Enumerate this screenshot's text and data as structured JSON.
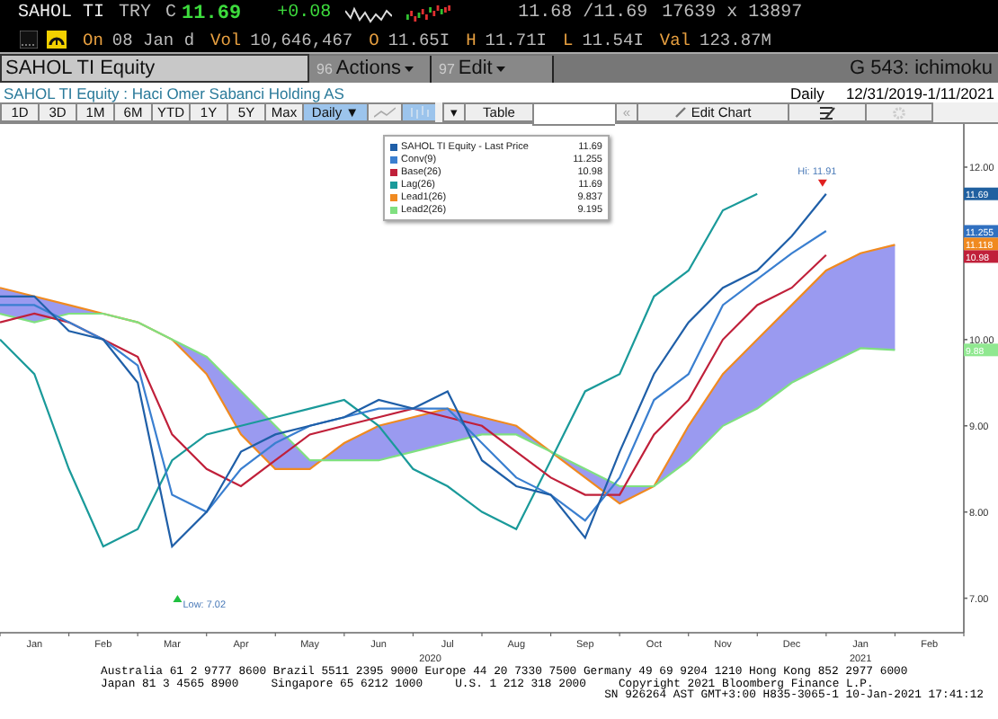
{
  "quote": {
    "ticker": "SAHOL TI",
    "currency": "TRY",
    "price_flag": "C",
    "last": "11.69",
    "change": "+0.08",
    "bid_ask": "11.68 /11.69",
    "size": "17639 x 13897"
  },
  "stats": [
    {
      "label": "On",
      "value": "08 Jan d"
    },
    {
      "label": "Vol",
      "value": "10,646,467"
    },
    {
      "label": "O",
      "value": "11.65I"
    },
    {
      "label": "H",
      "value": "11.71I"
    },
    {
      "label": "L",
      "value": "11.54I"
    },
    {
      "label": "Val",
      "value": "123.87M"
    }
  ],
  "command_bar": {
    "security": "SAHOL TI Equity",
    "menus": [
      {
        "number": "96",
        "label": "Actions"
      },
      {
        "number": "97",
        "label": "Edit"
      }
    ],
    "function": "G 543: ichimoku"
  },
  "chart_header": {
    "title": "SAHOL TI Equity : Haci Omer Sabanci Holding AS",
    "periodicity": "Daily",
    "range": "12/31/2019-1/11/2021"
  },
  "toolbar": {
    "ranges": [
      {
        "label": "1D",
        "selected": false
      },
      {
        "label": "3D",
        "selected": false
      },
      {
        "label": "1M",
        "selected": false
      },
      {
        "label": "6M",
        "selected": false
      },
      {
        "label": "YTD",
        "selected": false
      },
      {
        "label": "1Y",
        "selected": false
      },
      {
        "label": "5Y",
        "selected": false
      },
      {
        "label": "Max",
        "selected": false
      }
    ],
    "interval": "Daily ▼",
    "dropdown": "▾",
    "table": "Table",
    "back": "«",
    "edit": "Edit Chart"
  },
  "legend_values": [
    "11.69",
    "11.255",
    "10.98",
    "11.69",
    "9.837",
    "9.195"
  ],
  "value_tags": [
    {
      "value": "11.69",
      "color": "#2060a0"
    },
    {
      "value": "11.255",
      "color": "#3070c0"
    },
    {
      "value": "11.118",
      "color": "#f08a20"
    },
    {
      "value": "10.98",
      "color": "#c0203a"
    },
    {
      "value": "9.88",
      "color": "#90e890"
    }
  ],
  "x_axis_years": [
    {
      "label": "2020"
    },
    {
      "label": "2021"
    }
  ],
  "chart_data": {
    "type": "line",
    "categories": [
      null,
      "Jan",
      null,
      "Feb",
      null,
      "Mar",
      null,
      "Apr",
      null,
      "May",
      null,
      "Jun",
      null,
      "Jul",
      null,
      "Aug",
      null,
      "Sep",
      null,
      "Oct",
      null,
      "Nov",
      null,
      "Dec",
      null,
      "Jan",
      null,
      "Feb"
    ],
    "ylim": [
      6.6,
      12.5
    ],
    "yticks": [
      {
        "value": 7,
        "label": "7.00"
      },
      {
        "value": 8,
        "label": "8.00"
      },
      {
        "value": 9,
        "label": "9.00"
      },
      {
        "value": 10,
        "label": "10.00"
      },
      {
        "value": 12,
        "label": "12.00"
      }
    ],
    "series": [
      {
        "name": "SAHOL TI Equity - Last Price",
        "color": "#1f5fa8",
        "values": [
          10.5,
          10.5,
          10.1,
          10.0,
          9.5,
          7.6,
          8.0,
          8.7,
          8.9,
          9.0,
          9.1,
          9.3,
          9.2,
          9.4,
          8.6,
          8.3,
          8.2,
          7.7,
          8.7,
          9.6,
          10.2,
          10.6,
          10.8,
          11.2,
          11.69,
          null,
          null,
          null
        ]
      },
      {
        "name": "Conv(9)",
        "color": "#3a7fd0",
        "values": [
          10.4,
          10.4,
          10.2,
          10.0,
          9.7,
          8.2,
          8.0,
          8.5,
          8.8,
          9.0,
          9.1,
          9.2,
          9.2,
          9.2,
          8.8,
          8.4,
          8.2,
          7.9,
          8.4,
          9.3,
          9.6,
          10.4,
          10.7,
          11.0,
          11.26,
          null,
          null,
          null
        ]
      },
      {
        "name": "Base(26)",
        "color": "#c0203a",
        "values": [
          10.2,
          10.3,
          10.2,
          10.0,
          9.8,
          8.9,
          8.5,
          8.3,
          8.6,
          8.9,
          9.0,
          9.1,
          9.2,
          9.1,
          9.0,
          8.7,
          8.4,
          8.2,
          8.2,
          8.9,
          9.3,
          10.0,
          10.4,
          10.6,
          10.98,
          null,
          null,
          null
        ]
      },
      {
        "name": "Lag(26)",
        "color": "#1a9a9a",
        "values": [
          10.0,
          9.6,
          8.5,
          7.6,
          7.8,
          8.6,
          8.9,
          9.0,
          9.1,
          9.2,
          9.3,
          9.0,
          8.5,
          8.3,
          8.0,
          7.8,
          8.6,
          9.4,
          9.6,
          10.5,
          10.8,
          11.5,
          11.69,
          null,
          null,
          null,
          null,
          null
        ]
      },
      {
        "name": "Lead1(26)",
        "color": "#f08a20",
        "values": [
          10.6,
          10.5,
          10.4,
          10.3,
          10.2,
          10.0,
          9.6,
          8.9,
          8.5,
          8.5,
          8.8,
          9.0,
          9.1,
          9.2,
          9.1,
          9.0,
          8.7,
          8.4,
          8.1,
          8.3,
          9.0,
          9.6,
          10.0,
          10.4,
          10.8,
          11.0,
          11.1,
          null
        ]
      },
      {
        "name": "Lead2(26)",
        "color": "#80e080",
        "values": [
          10.3,
          10.2,
          10.3,
          10.3,
          10.2,
          10.0,
          9.8,
          9.4,
          9.0,
          8.6,
          8.6,
          8.6,
          8.7,
          8.8,
          8.9,
          8.9,
          8.7,
          8.5,
          8.3,
          8.3,
          8.6,
          9.0,
          9.2,
          9.5,
          9.7,
          9.9,
          9.88,
          null
        ]
      }
    ],
    "legend": "top",
    "annotations": [
      "Hi: 11.91",
      "Low: 7.02"
    ]
  },
  "footer": {
    "lines": [
      [
        "Australia 61 2 9777 8600 Brazil 5511 2395 9000 Europe 44 20 7330 7500 Germany 49 69 9204 1210 Hong Kong 852 2977 6000"
      ],
      [
        "Japan 81 3 4565 8900",
        "Singapore 65 6212 1000",
        "U.S. 1 212 318 2000",
        "Copyright 2021 Bloomberg Finance L.P."
      ],
      [
        "SN 926264 AST GMT+3:00 H835-3065-1 10-Jan-2021 17:41:12"
      ]
    ]
  }
}
